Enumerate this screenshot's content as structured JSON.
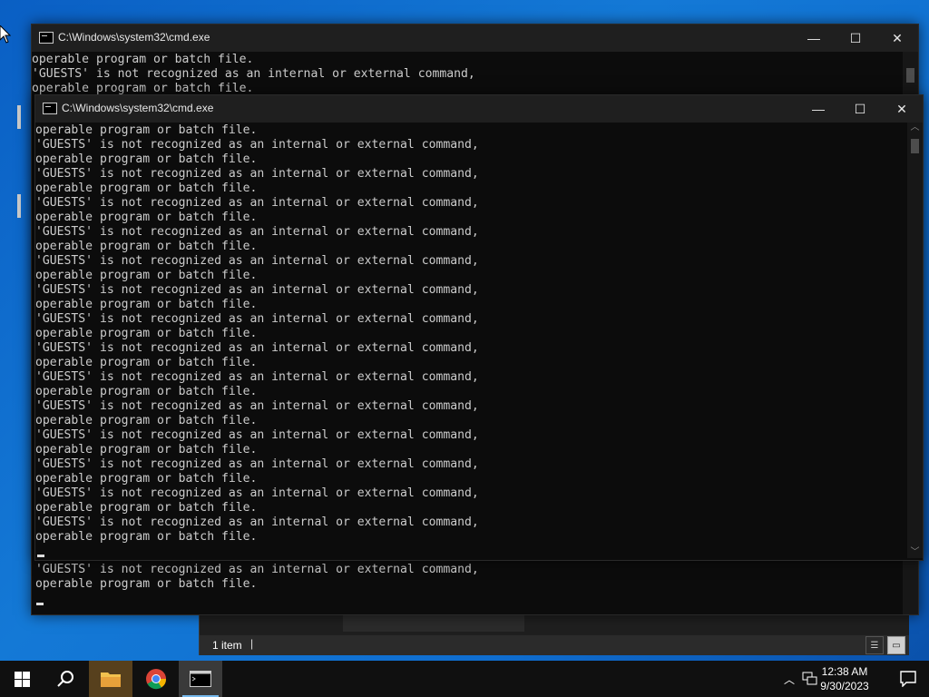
{
  "windows": {
    "back_cmd": {
      "title": "C:\\Windows\\system32\\cmd.exe",
      "lines": [
        "operable program or batch file.",
        "'GUESTS' is not recognized as an internal or external command,",
        "operable program or batch file."
      ]
    },
    "front_cmd": {
      "title": "C:\\Windows\\system32\\cmd.exe",
      "lines": [
        "operable program or batch file.",
        "'GUESTS' is not recognized as an internal or external command,",
        "operable program or batch file.",
        "'GUESTS' is not recognized as an internal or external command,",
        "operable program or batch file.",
        "'GUESTS' is not recognized as an internal or external command,",
        "operable program or batch file.",
        "'GUESTS' is not recognized as an internal or external command,",
        "operable program or batch file.",
        "'GUESTS' is not recognized as an internal or external command,",
        "operable program or batch file.",
        "'GUESTS' is not recognized as an internal or external command,",
        "operable program or batch file.",
        "'GUESTS' is not recognized as an internal or external command,",
        "operable program or batch file.",
        "'GUESTS' is not recognized as an internal or external command,",
        "operable program or batch file.",
        "'GUESTS' is not recognized as an internal or external command,",
        "operable program or batch file.",
        "'GUESTS' is not recognized as an internal or external command,",
        "operable program or batch file.",
        "'GUESTS' is not recognized as an internal or external command,",
        "operable program or batch file.",
        "'GUESTS' is not recognized as an internal or external command,",
        "operable program or batch file.",
        "'GUESTS' is not recognized as an internal or external command,",
        "operable program or batch file.",
        "'GUESTS' is not recognized as an internal or external command,",
        "operable program or batch file."
      ],
      "lower_pane_lines": [
        "'GUESTS' is not recognized as an internal or external command,",
        "operable program or batch file."
      ]
    }
  },
  "controls": {
    "minimize": "—",
    "maximize": "☐",
    "close": "✕"
  },
  "explorer": {
    "status_count": "1 item",
    "separator": "|"
  },
  "taskbar": {
    "time": "12:38 AM",
    "date": "9/30/2023",
    "apps": [
      "start-icon",
      "search-icon",
      "file-explorer-icon",
      "chrome-icon",
      "command-prompt-icon"
    ],
    "accent": "#76b9ed"
  }
}
